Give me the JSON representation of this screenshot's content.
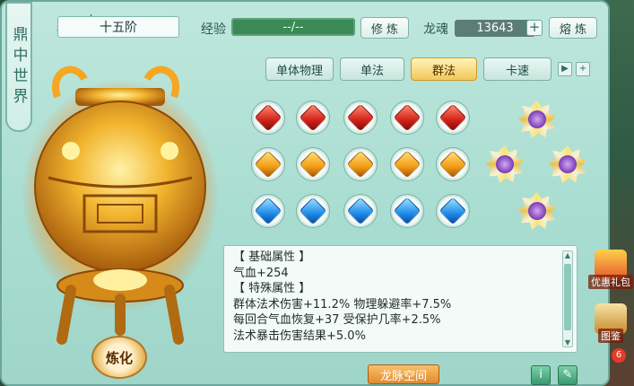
{
  "side_title": "鼎中世界",
  "stage": "十五阶",
  "exp": {
    "label": "经验",
    "value": "--/--",
    "button": "修 炼"
  },
  "soul": {
    "label": "龙魂",
    "value": "13643",
    "plus": "+",
    "button": "熔 炼"
  },
  "tabs": [
    {
      "label": "单体物理",
      "active": false
    },
    {
      "label": "单法",
      "active": false
    },
    {
      "label": "群法",
      "active": true
    },
    {
      "label": "卡速",
      "active": false
    }
  ],
  "tab_more": "▶",
  "tab_add": "+",
  "gem_rows": [
    {
      "color": "red",
      "count": 5
    },
    {
      "color": "orange",
      "count": 5
    },
    {
      "color": "blue",
      "count": 5
    }
  ],
  "info": {
    "lines": [
      "【 基础属性 】",
      "气血+254",
      "【 特殊属性 】",
      "群体法术伤害+11.2%  物理躲避率+7.5%",
      "每回合气血恢复+37  受保护几率+2.5%",
      "法术暴击伤害结果+5.0%"
    ]
  },
  "refine_button": "炼化",
  "vein_button": "龙脉空间",
  "info_button": "i",
  "edit_button": "✎",
  "side_icons": [
    {
      "label": "优惠礼包"
    },
    {
      "label": "图鉴"
    }
  ],
  "badge_count": "6",
  "colors": {
    "accent": "#f2c85a",
    "panel": "#bfe7dd",
    "exp_bar": "#3a8a55"
  }
}
